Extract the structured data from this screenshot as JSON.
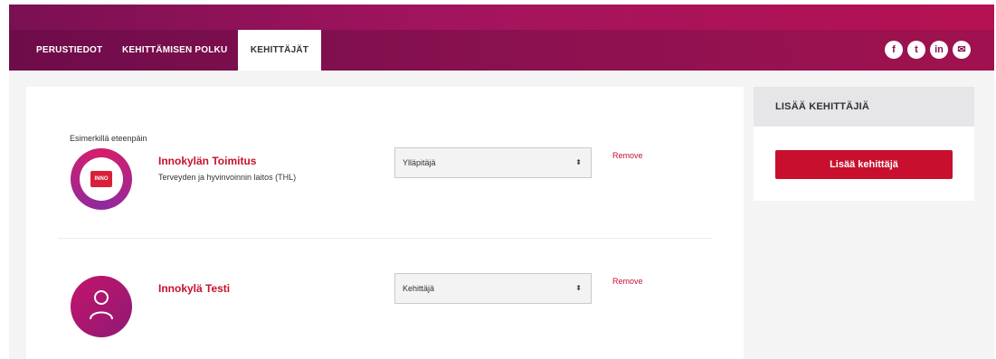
{
  "nav": {
    "tabs": [
      {
        "label": "PERUSTIEDOT"
      },
      {
        "label": "KEHITTÄMISEN POLKU"
      },
      {
        "label": "KEHITTÄJÄT"
      }
    ],
    "active_tab": "KEHITTÄJÄT",
    "social": [
      {
        "icon": "facebook-icon",
        "glyph": "f"
      },
      {
        "icon": "twitter-icon",
        "glyph": "t"
      },
      {
        "icon": "linkedin-icon",
        "glyph": "in"
      },
      {
        "icon": "email-icon",
        "glyph": "✉"
      }
    ]
  },
  "developers": {
    "group_label": "Esimerkillä eteenpäin",
    "rows": [
      {
        "name": "Innokylän Toimitus",
        "organization": "Terveyden ja hyvinvoinnin laitos (THL)",
        "role": "Ylläpitäjä",
        "remove_label": "Remove",
        "logo_text": "INNO"
      },
      {
        "name": "Innokylä Testi",
        "role": "Kehittäjä",
        "remove_label": "Remove"
      }
    ]
  },
  "sidebar": {
    "title": "LISÄÄ KEHITTÄJIÄ",
    "add_button": "Lisää kehittäjä"
  },
  "colors": {
    "brand": "#c8102e",
    "nav": "#8a1150"
  }
}
